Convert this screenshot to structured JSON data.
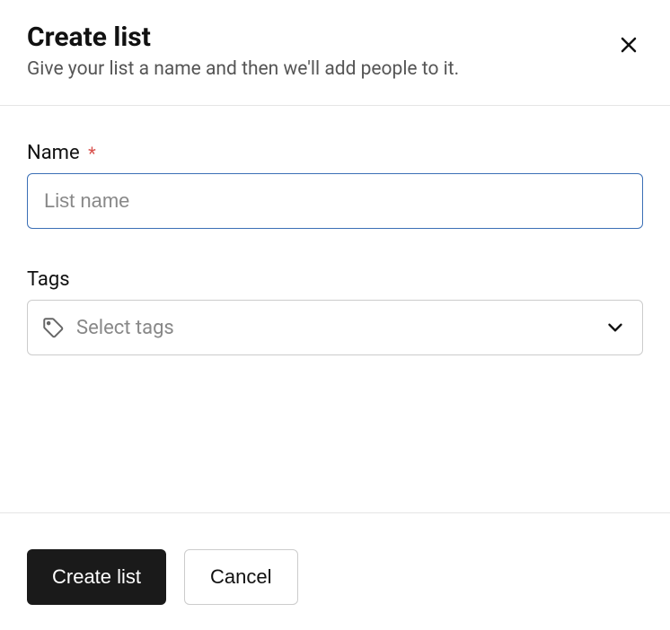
{
  "header": {
    "title": "Create list",
    "subtitle": "Give your list a name and then we'll add people to it."
  },
  "fields": {
    "name": {
      "label": "Name",
      "required_marker": "*",
      "placeholder": "List name",
      "value": ""
    },
    "tags": {
      "label": "Tags",
      "placeholder": "Select tags",
      "value": ""
    }
  },
  "actions": {
    "primary": "Create list",
    "secondary": "Cancel"
  }
}
